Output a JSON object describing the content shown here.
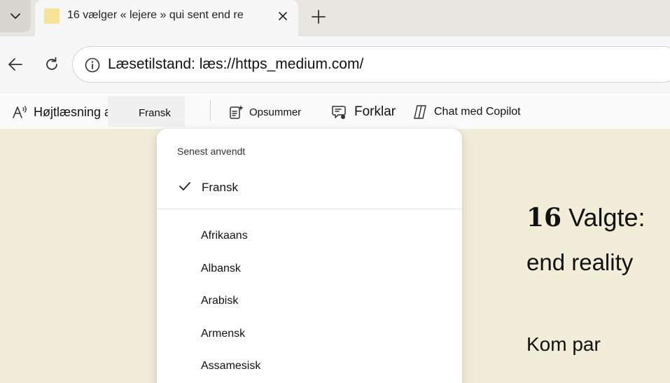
{
  "tab": {
    "title": "16 vælger « lejere » qui sent end re"
  },
  "address_bar": {
    "url": "Læsetilstand: læs://https_medium.com/"
  },
  "reader_toolbar": {
    "read_aloud_label": "Højtlæsning ab",
    "language_value": "Fransk",
    "summarize_label": "Opsummer",
    "explain_label": "Forklar",
    "copilot_label": "Chat med Copilot"
  },
  "language_dropdown": {
    "recent_heading": "Senest anvendt",
    "recent_selected": "Fransk",
    "languages": [
      "Afrikaans",
      "Albansk",
      "Arabisk",
      "Armensk",
      "Assamesisk"
    ]
  },
  "article": {
    "title_number": "16",
    "title_line1": "Valgte:",
    "title_line2": "end reality",
    "body_start": "Kom par"
  },
  "colors": {
    "page_background": "#f1edd9",
    "favicon": "#f6e39a"
  }
}
